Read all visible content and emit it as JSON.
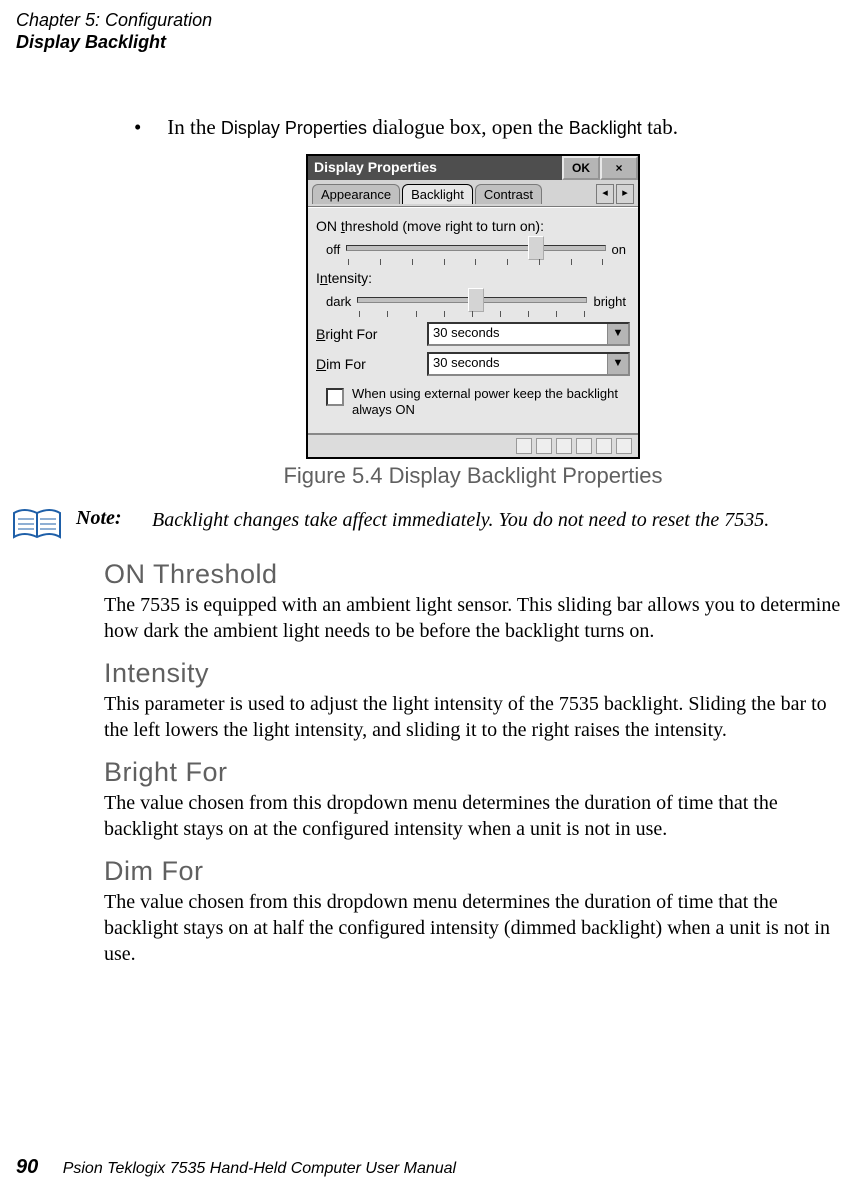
{
  "header": {
    "line1": "Chapter 5: Configuration",
    "line2": "Display Backlight"
  },
  "bullet": {
    "pre": "In the ",
    "ss1": "Display Properties",
    "mid": " dialogue box, open the ",
    "ss2": "Backlight",
    "post": " tab."
  },
  "window": {
    "title": "Display Properties",
    "ok": "OK",
    "close": "×",
    "tabs": {
      "appearance": "Appearance",
      "backlight": "Backlight",
      "contrast": "Contrast"
    },
    "scroll_left": "◂",
    "scroll_right": "▸",
    "on_threshold_label": "ON threshold (move right to turn on):",
    "off": "off",
    "on": "on",
    "intensity_label": "Intensity:",
    "dark": "dark",
    "bright": "bright",
    "bright_for_label": "Bright For",
    "bright_for_val": "30 seconds",
    "dim_for_label": "Dim For",
    "dim_for_val": "30 seconds",
    "checkbox_text": "When using external power keep the backlight always ON",
    "dd_arrow": "▼"
  },
  "caption": "Figure 5.4 Display Backlight Properties",
  "note": {
    "label": "Note:",
    "body": "Backlight changes take affect immediately. You do not need to reset the 7535."
  },
  "sections": {
    "on_threshold": {
      "heading": "ON Threshold",
      "body": "The 7535 is equipped with an ambient light sensor. This sliding bar allows you to determine how dark the ambient light needs to be before the backlight turns on."
    },
    "intensity": {
      "heading": "Intensity",
      "body": "This parameter is used to adjust the light intensity of the 7535 backlight. Sliding the bar to the left lowers the light intensity, and sliding it to the right raises the intensity."
    },
    "bright_for": {
      "heading": "Bright For",
      "body": "The value chosen from this dropdown menu determines the duration of time that the backlight stays on at the configured intensity when a unit is not in use."
    },
    "dim_for": {
      "heading": "Dim For",
      "body": "The value chosen from this dropdown menu determines the duration of time that the backlight stays on at half the configured intensity (dimmed backlight) when a unit is not in use."
    }
  },
  "footer": {
    "page": "90",
    "book": "Psion Teklogix 7535 Hand-Held Computer User Manual"
  }
}
